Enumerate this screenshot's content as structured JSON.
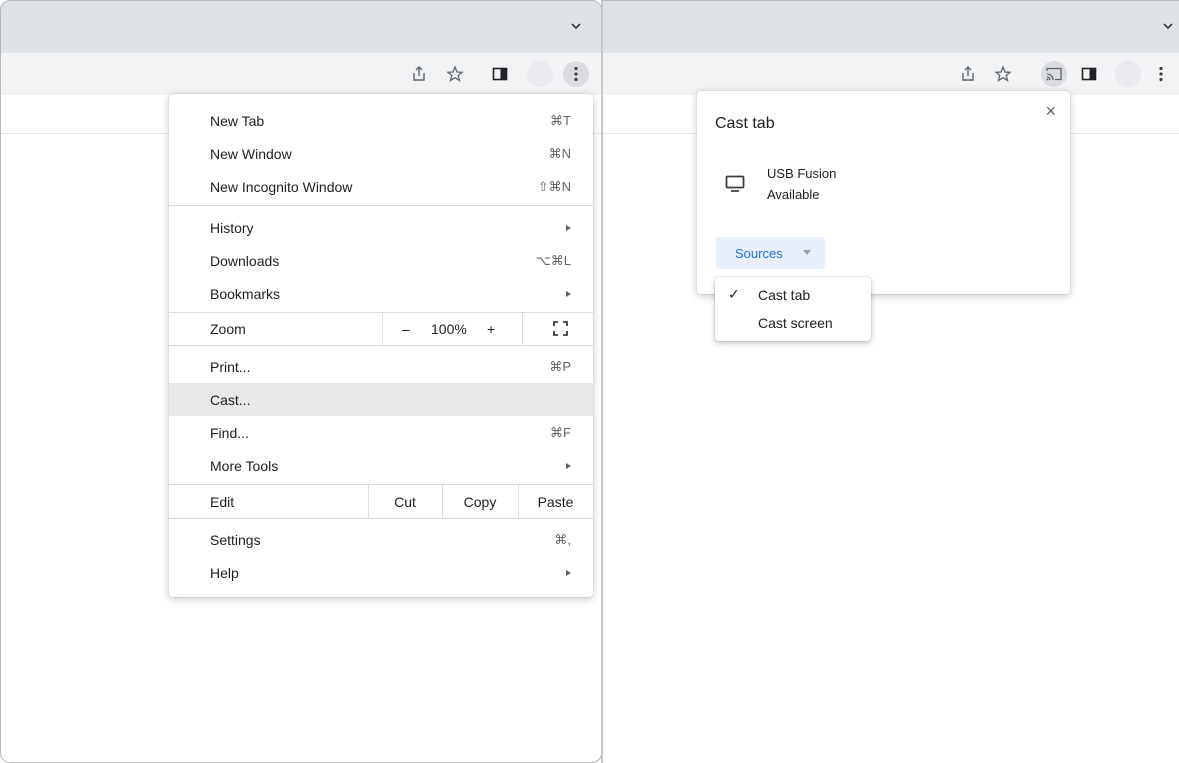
{
  "left_window": {
    "menu": {
      "section1": [
        {
          "label": "New Tab",
          "shortcut": "⌘T"
        },
        {
          "label": "New Window",
          "shortcut": "⌘N"
        },
        {
          "label": "New Incognito Window",
          "shortcut": "⇧⌘N"
        }
      ],
      "section2": [
        {
          "label": "History",
          "has_submenu": true
        },
        {
          "label": "Downloads",
          "shortcut": "⌥⌘L"
        },
        {
          "label": "Bookmarks",
          "has_submenu": true
        }
      ],
      "zoom": {
        "label": "Zoom",
        "minus": "–",
        "value": "100%",
        "plus": "+"
      },
      "section3": [
        {
          "label": "Print...",
          "shortcut": "⌘P"
        },
        {
          "label": "Cast...",
          "highlighted": true
        },
        {
          "label": "Find...",
          "shortcut": "⌘F"
        },
        {
          "label": "More Tools",
          "has_submenu": true
        }
      ],
      "edit": {
        "label": "Edit",
        "cut": "Cut",
        "copy": "Copy",
        "paste": "Paste"
      },
      "section4": [
        {
          "label": "Settings",
          "shortcut": "⌘,"
        },
        {
          "label": "Help",
          "has_submenu": true
        }
      ]
    }
  },
  "right_window": {
    "cast_dialog": {
      "title": "Cast tab",
      "close": "×",
      "sink": {
        "name": "USB Fusion",
        "status": "Available"
      },
      "sources_button": "Sources"
    },
    "sources_menu": {
      "items": [
        {
          "label": "Cast tab",
          "checked": true,
          "check": "✓"
        },
        {
          "label": "Cast screen",
          "checked": false
        }
      ]
    }
  },
  "colors": {
    "tabstrip": "#dee1e6",
    "toolbar": "#f1f3f4",
    "menu_highlight": "#e8e8e8",
    "accent_blue": "#1a73e8",
    "sources_bg": "#e8f0fe"
  },
  "icons": [
    "chevron-down-icon",
    "share-icon",
    "star-icon",
    "side-panel-icon",
    "cast-icon",
    "kebab-menu-icon",
    "fullscreen-icon",
    "monitor-icon",
    "close-icon"
  ]
}
